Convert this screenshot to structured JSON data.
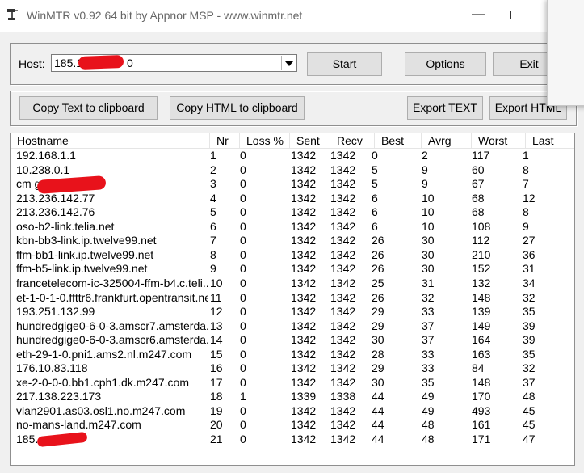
{
  "window": {
    "title": "WinMTR v0.92 64 bit by Appnor MSP - www.winmtr.net",
    "minimize_glyph": "—",
    "app_icon": "winmtr-icon"
  },
  "host": {
    "label": "Host:",
    "value": "185.1",
    "value_suffix": "0"
  },
  "buttons": {
    "start": "Start",
    "options": "Options",
    "exit": "Exit",
    "copy_text": "Copy Text to clipboard",
    "copy_html": "Copy HTML to clipboard",
    "export_text": "Export TEXT",
    "export_html": "Export HTML"
  },
  "table": {
    "columns": [
      "Hostname",
      "Nr",
      "Loss %",
      "Sent",
      "Recv",
      "Best",
      "Avrg",
      "Worst",
      "Last"
    ],
    "rows": [
      {
        "hostname": "192.168.1.1",
        "nr": "1",
        "loss": "0",
        "sent": "1342",
        "recv": "1342",
        "best": "0",
        "avrg": "2",
        "worst": "117",
        "last": "1"
      },
      {
        "hostname": "10.238.0.1",
        "nr": "2",
        "loss": "0",
        "sent": "1342",
        "recv": "1342",
        "best": "5",
        "avrg": "9",
        "worst": "60",
        "last": "8"
      },
      {
        "hostname": "cm                  getinternet.no",
        "nr": "3",
        "loss": "0",
        "sent": "1342",
        "recv": "1342",
        "best": "5",
        "avrg": "9",
        "worst": "67",
        "last": "7"
      },
      {
        "hostname": "213.236.142.77",
        "nr": "4",
        "loss": "0",
        "sent": "1342",
        "recv": "1342",
        "best": "6",
        "avrg": "10",
        "worst": "68",
        "last": "12"
      },
      {
        "hostname": "213.236.142.76",
        "nr": "5",
        "loss": "0",
        "sent": "1342",
        "recv": "1342",
        "best": "6",
        "avrg": "10",
        "worst": "68",
        "last": "8"
      },
      {
        "hostname": "oso-b2-link.telia.net",
        "nr": "6",
        "loss": "0",
        "sent": "1342",
        "recv": "1342",
        "best": "6",
        "avrg": "10",
        "worst": "108",
        "last": "9"
      },
      {
        "hostname": "kbn-bb3-link.ip.twelve99.net",
        "nr": "7",
        "loss": "0",
        "sent": "1342",
        "recv": "1342",
        "best": "26",
        "avrg": "30",
        "worst": "112",
        "last": "27"
      },
      {
        "hostname": "ffm-bb1-link.ip.twelve99.net",
        "nr": "8",
        "loss": "0",
        "sent": "1342",
        "recv": "1342",
        "best": "26",
        "avrg": "30",
        "worst": "210",
        "last": "36"
      },
      {
        "hostname": "ffm-b5-link.ip.twelve99.net",
        "nr": "9",
        "loss": "0",
        "sent": "1342",
        "recv": "1342",
        "best": "26",
        "avrg": "30",
        "worst": "152",
        "last": "31"
      },
      {
        "hostname": "francetelecom-ic-325004-ffm-b4.c.teli...",
        "nr": "10",
        "loss": "0",
        "sent": "1342",
        "recv": "1342",
        "best": "25",
        "avrg": "31",
        "worst": "132",
        "last": "34"
      },
      {
        "hostname": "et-1-0-1-0.ffttr6.frankfurt.opentransit.net",
        "nr": "11",
        "loss": "0",
        "sent": "1342",
        "recv": "1342",
        "best": "26",
        "avrg": "32",
        "worst": "148",
        "last": "32"
      },
      {
        "hostname": "193.251.132.99",
        "nr": "12",
        "loss": "0",
        "sent": "1342",
        "recv": "1342",
        "best": "29",
        "avrg": "33",
        "worst": "139",
        "last": "35"
      },
      {
        "hostname": "hundredgige0-6-0-3.amscr7.amsterda...",
        "nr": "13",
        "loss": "0",
        "sent": "1342",
        "recv": "1342",
        "best": "29",
        "avrg": "37",
        "worst": "149",
        "last": "39"
      },
      {
        "hostname": "hundredgige0-6-0-3.amscr6.amsterda...",
        "nr": "14",
        "loss": "0",
        "sent": "1342",
        "recv": "1342",
        "best": "30",
        "avrg": "37",
        "worst": "164",
        "last": "39"
      },
      {
        "hostname": "eth-29-1-0.pni1.ams2.nl.m247.com",
        "nr": "15",
        "loss": "0",
        "sent": "1342",
        "recv": "1342",
        "best": "28",
        "avrg": "33",
        "worst": "163",
        "last": "35"
      },
      {
        "hostname": "176.10.83.118",
        "nr": "16",
        "loss": "0",
        "sent": "1342",
        "recv": "1342",
        "best": "29",
        "avrg": "33",
        "worst": "84",
        "last": "32"
      },
      {
        "hostname": "xe-2-0-0-0.bb1.cph1.dk.m247.com",
        "nr": "17",
        "loss": "0",
        "sent": "1342",
        "recv": "1342",
        "best": "30",
        "avrg": "35",
        "worst": "148",
        "last": "37"
      },
      {
        "hostname": "217.138.223.173",
        "nr": "18",
        "loss": "1",
        "sent": "1339",
        "recv": "1338",
        "best": "44",
        "avrg": "49",
        "worst": "170",
        "last": "48"
      },
      {
        "hostname": "vlan2901.as03.osl1.no.m247.com",
        "nr": "19",
        "loss": "0",
        "sent": "1342",
        "recv": "1342",
        "best": "44",
        "avrg": "49",
        "worst": "493",
        "last": "45"
      },
      {
        "hostname": "no-mans-land.m247.com",
        "nr": "20",
        "loss": "0",
        "sent": "1342",
        "recv": "1342",
        "best": "44",
        "avrg": "48",
        "worst": "161",
        "last": "45"
      },
      {
        "hostname": "185.",
        "nr": "21",
        "loss": "0",
        "sent": "1342",
        "recv": "1342",
        "best": "44",
        "avrg": "48",
        "worst": "171",
        "last": "47"
      }
    ]
  }
}
